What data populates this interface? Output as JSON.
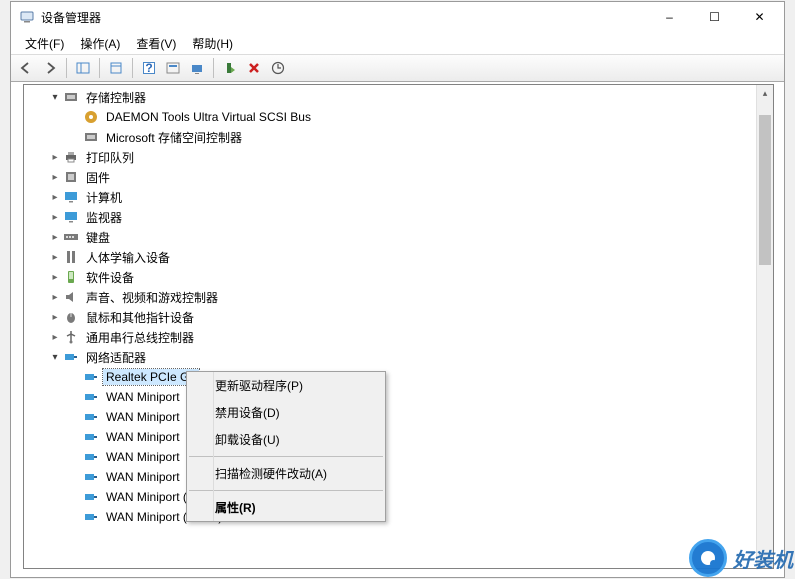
{
  "window_title": "设备管理器",
  "window_controls": {
    "minimize": "–",
    "maximize": "☐",
    "close": "✕"
  },
  "menu": {
    "file": "文件(F)",
    "action": "操作(A)",
    "view": "查看(V)",
    "help": "帮助(H)"
  },
  "tree": {
    "storage_controllers": {
      "label": "存储控制器",
      "expanded": true,
      "children": {
        "daemon": "DAEMON Tools Ultra Virtual SCSI Bus",
        "msstore": "Microsoft 存储空间控制器"
      }
    },
    "print_queues": {
      "label": "打印队列"
    },
    "firmware": {
      "label": "固件"
    },
    "computer": {
      "label": "计算机"
    },
    "monitors": {
      "label": "监视器"
    },
    "keyboards": {
      "label": "键盘"
    },
    "hid": {
      "label": "人体学输入设备"
    },
    "software_devices": {
      "label": "软件设备"
    },
    "sound": {
      "label": "声音、视频和游戏控制器"
    },
    "mice": {
      "label": "鼠标和其他指针设备"
    },
    "usb": {
      "label": "通用串行总线控制器"
    },
    "network_adapters": {
      "label": "网络适配器",
      "expanded": true,
      "children": {
        "realtek": "Realtek PCIe Gb",
        "wan1": "WAN Miniport",
        "wan2": "WAN Miniport",
        "wan3": "WAN Miniport",
        "wan4": "WAN Miniport",
        "wan5": "WAN Miniport",
        "wan_pptp": "WAN Miniport (PPTP)",
        "wan_sstp": "WAN Miniport (SSTP)"
      }
    }
  },
  "context_menu": {
    "update_driver": "更新驱动程序(P)",
    "disable_device": "禁用设备(D)",
    "uninstall_device": "卸载设备(U)",
    "scan_hardware": "扫描检测硬件改动(A)",
    "properties": "属性(R)"
  },
  "watermark": "好装机"
}
